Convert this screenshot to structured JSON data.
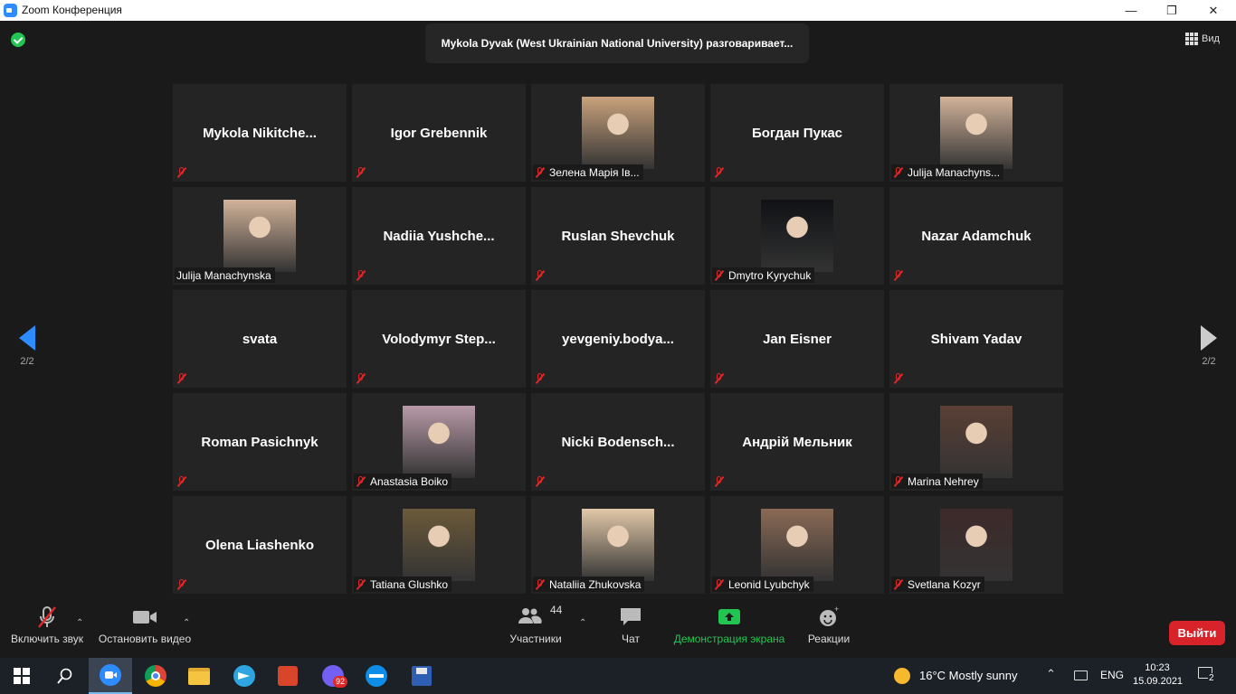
{
  "window": {
    "title": "Zoom Конференция"
  },
  "meeting": {
    "active_speaker": "Mykola Dyvak (West Ukrainian National University) разговаривает...",
    "view_label": "Вид",
    "page_left": "2/2",
    "page_right": "2/2"
  },
  "participants": [
    {
      "name": "Mykola  Nikitche...",
      "photo": false
    },
    {
      "name": "Igor Grebennik",
      "photo": false
    },
    {
      "name": "Зелена Марія Ів...",
      "photo": true,
      "color": "#c9a27c"
    },
    {
      "name": "Богдан Пукас",
      "photo": false
    },
    {
      "name": "Julija Manachyns...",
      "photo": true,
      "color": "#d2b39a"
    },
    {
      "name": "Julija Manachynska",
      "photo": true,
      "color": "#d2b39a",
      "mic_on": true
    },
    {
      "name": "Nadiia  Yushche...",
      "photo": false
    },
    {
      "name": "Ruslan Shevchuk",
      "photo": false
    },
    {
      "name": "Dmytro Kyrychuk",
      "photo": true,
      "color": "#101215"
    },
    {
      "name": "Nazar Adamchuk",
      "photo": false
    },
    {
      "name": "svata",
      "photo": false
    },
    {
      "name": "Volodymyr  Step...",
      "photo": false
    },
    {
      "name": "yevgeniy.bodya...",
      "photo": false
    },
    {
      "name": "Jan Eisner",
      "photo": false
    },
    {
      "name": "Shivam Yadav",
      "photo": false
    },
    {
      "name": "Roman Pasichnyk",
      "photo": false
    },
    {
      "name": "Anastasia Boiko",
      "photo": true,
      "color": "#b89aa8"
    },
    {
      "name": "Nicki  Bodensch...",
      "photo": false
    },
    {
      "name": "Андрій Мельник",
      "photo": false
    },
    {
      "name": "Marina Nehrey",
      "photo": true,
      "color": "#5a3f35"
    },
    {
      "name": "Olena Liashenko",
      "photo": false
    },
    {
      "name": "Tatiana Glushko",
      "photo": true,
      "color": "#6b5a3a"
    },
    {
      "name": "Nataliia Zhukovska",
      "photo": true,
      "color": "#e2c8a8"
    },
    {
      "name": "Leonid Lyubchyk",
      "photo": true,
      "color": "#8a6a55"
    },
    {
      "name": "Svetlana Kozyr",
      "photo": true,
      "color": "#3e2a2a"
    }
  ],
  "toolbar": {
    "mute_label": "Включить звук",
    "video_label": "Остановить видео",
    "participants_label": "Участники",
    "participants_count": "44",
    "chat_label": "Чат",
    "share_label": "Демонстрация экрана",
    "reactions_label": "Реакции",
    "leave_label": "Выйти"
  },
  "taskbar": {
    "weather": "16°C  Mostly sunny",
    "lang": "ENG",
    "time": "10:23",
    "date": "15.09.2021",
    "viber_badge": "92",
    "notifications": "2"
  },
  "colors": {
    "accent": "#2d8cff",
    "share_green": "#23c552",
    "leave_red": "#d8232a",
    "mute_red": "#e02828"
  }
}
